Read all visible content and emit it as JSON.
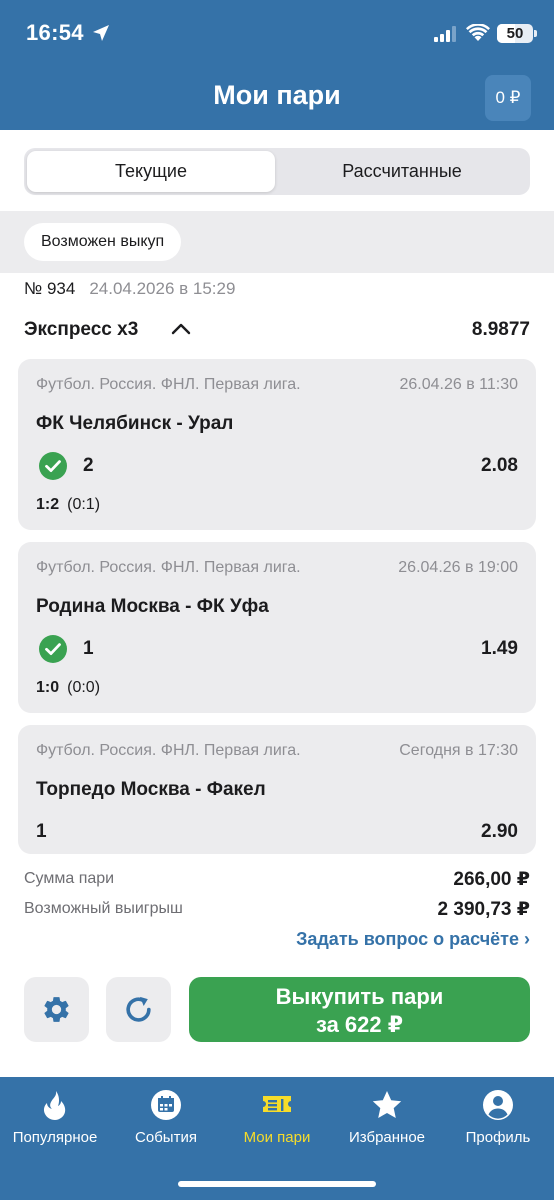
{
  "status_bar": {
    "time": "16:54",
    "battery": "50",
    "battery_level": 0.5
  },
  "header": {
    "title": "Мои пари",
    "balance": "0 ₽"
  },
  "tabs": {
    "current": "Текущие",
    "settled": "Рассчитанные",
    "active": "current"
  },
  "chip": "Возможен выкуп",
  "bet": {
    "number": "№ 934",
    "date": "24.04.2026 в 15:29",
    "type": "Экспресс x3",
    "total_coef": "8.9877",
    "events": [
      {
        "league": "Футбол. Россия. ФНЛ. Первая лига.",
        "time": "26.04.26 в 11:30",
        "teams": "ФК Челябинск - Урал",
        "outcome": "2",
        "won": true,
        "coef": "2.08",
        "score": "1:2",
        "half": "(0:1)"
      },
      {
        "league": "Футбол. Россия. ФНЛ. Первая лига.",
        "time": "26.04.26 в 19:00",
        "teams": "Родина Москва - ФК Уфа",
        "outcome": "1",
        "won": true,
        "coef": "1.49",
        "score": "1:0",
        "half": "(0:0)"
      },
      {
        "league": "Футбол. Россия. ФНЛ. Первая лига.",
        "time": "Сегодня в 17:30",
        "teams": "Торпедо Москва - Факел",
        "outcome": "1",
        "won": false,
        "coef": "2.90",
        "score": "",
        "half": ""
      }
    ]
  },
  "summary": {
    "stake_label": "Сумма пари",
    "stake_value": "266,00 ₽",
    "win_label": "Возможный выигрыш",
    "win_value": "2 390,73 ₽",
    "ask_link": "Задать вопрос о расчёте ›"
  },
  "actions": {
    "cashout_line1": "Выкупить пари",
    "cashout_line2": "за  622 ₽"
  },
  "nav": {
    "items": [
      {
        "label": "Популярное",
        "icon": "flame-icon"
      },
      {
        "label": "События",
        "icon": "calendar-icon"
      },
      {
        "label": "Мои пари",
        "icon": "ticket-icon"
      },
      {
        "label": "Избранное",
        "icon": "star-icon"
      },
      {
        "label": "Профиль",
        "icon": "profile-icon"
      }
    ],
    "active_index": 2
  },
  "colors": {
    "primary": "#3572a8",
    "success": "#3aa251",
    "active_nav": "#f6dc2a"
  }
}
